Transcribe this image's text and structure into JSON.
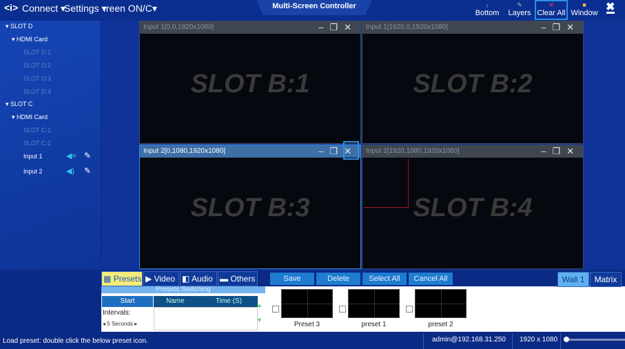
{
  "topbar": {
    "connect": "Connect",
    "settings": "Settings",
    "screen": ":reen ON/C",
    "title": "Multi-Screen Controller",
    "buttons": [
      {
        "label": "Bottom",
        "icon": "arrow-down-icon"
      },
      {
        "label": "Layers",
        "icon": "layers-icon"
      },
      {
        "label": "Clear All",
        "icon": "clear-x-icon"
      },
      {
        "label": "Window",
        "icon": "window-icon"
      }
    ]
  },
  "sidebar": {
    "slot_d": "SLOT D",
    "hdmi_d": "HDMI Card",
    "d_items": [
      "SLOT D:1",
      "SLOT D:2",
      "SLOT D:3",
      "SLOT D:4"
    ],
    "slot_c": "SLOT C",
    "hdmi_c": "HDMI Card",
    "c_items": [
      "SLOT C:1",
      "SLOT C:2"
    ],
    "inputs": [
      "Input 1",
      "Input 2"
    ]
  },
  "windows": [
    {
      "title": "Input 1[0,0,1920x1080]",
      "content": "SLOT B:1"
    },
    {
      "title": "Input 1[1920,0,1920x1080]",
      "content": "SLOT B:2"
    },
    {
      "title": "Input 2[0,1080,1920x1080]",
      "content": "SLOT B:3"
    },
    {
      "title": "Input 2[1920,1080,1920x1080]",
      "content": "SLOT B:4"
    }
  ],
  "bottom": {
    "tabs": [
      "Presets",
      "Video",
      "Audio",
      "Others"
    ],
    "actions": [
      "Save",
      "Delete",
      "Select All",
      "Cancel All"
    ],
    "wall_tabs": [
      "Wall 1",
      "Matrix"
    ],
    "switching": {
      "header": "Presets Switching",
      "start": "Start",
      "intervals": "Intervals:",
      "interval_value": "5 Seconds",
      "col_name": "Name",
      "col_time": "Time (S)"
    },
    "presets": [
      "Preset 3",
      "preset 1",
      "preset 2"
    ]
  },
  "status": {
    "message": "Load preset: double click the below preset icon.",
    "user": "admin@192.168.31.250",
    "resolution": "1920 x 1080"
  },
  "colors": {
    "accent": "#1f7cd0",
    "highlight": "#2b8fe8"
  }
}
